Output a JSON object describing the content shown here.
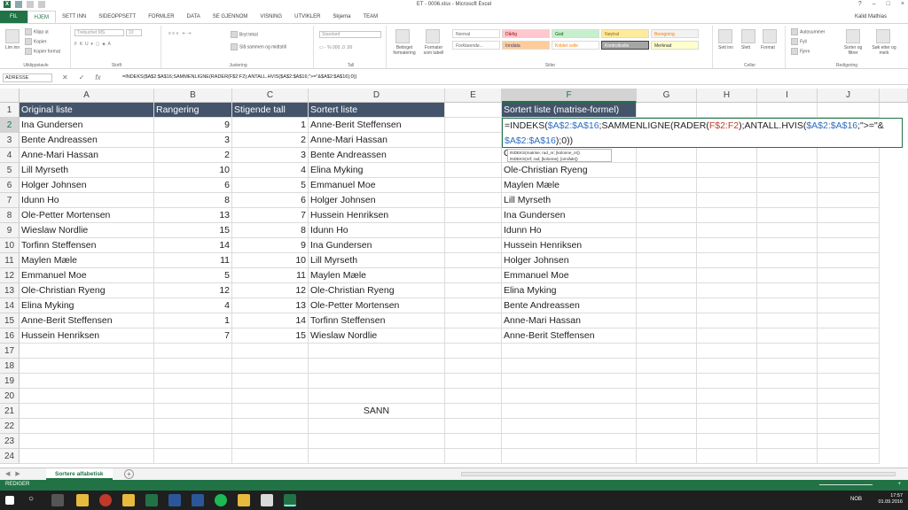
{
  "window": {
    "title": "ET - 0006.xlsx - Microsoft Excel",
    "user": "Kalid Mathias",
    "controls": [
      "?",
      "–",
      "□",
      "×"
    ]
  },
  "ribbon_tabs": [
    "FIL",
    "HJEM",
    "SETT INN",
    "SIDEOPPSETT",
    "FORMLER",
    "DATA",
    "SE GJENNOM",
    "VISNING",
    "UTVIKLER",
    "Skjema",
    "TEAM"
  ],
  "ribbon": {
    "clipboard": {
      "paste": "Lim inn",
      "cut": "Klipp ut",
      "copy": "Kopier",
      "format_painter": "Kopier format",
      "label": "Utklippstavle"
    },
    "font": {
      "family": "Trebuchet MS",
      "size": "10",
      "label": "Skrift"
    },
    "alignment": {
      "wrap": "Bryt tekst",
      "merge": "Slå sammen og midtstill",
      "label": "Justering"
    },
    "number": {
      "format": "Standard",
      "label": "Tall"
    },
    "styles": {
      "conditional": "Betinget formatering",
      "format_table": "Formater som tabell",
      "cells": [
        "Normal",
        "Dårlig",
        "God",
        "Nøytral",
        "Beregning",
        "Forklarende...",
        "Inndata",
        "Koblet celle",
        "Kontrollcelle",
        "Merknad"
      ],
      "label": "Stiler"
    },
    "cells": {
      "insert": "Sett inn",
      "delete": "Slett",
      "format": "Format",
      "label": "Celler"
    },
    "editing": {
      "autosum": "Autosummer",
      "fill": "Fyll",
      "clear": "Fjern",
      "sort": "Sorter og filtrer",
      "find": "Søk etter og merk",
      "label": "Redigering"
    }
  },
  "formula_bar": {
    "name_box": "ADRESSE",
    "formula": "=INDEKS($A$2:$A$16;SAMMENLIGNE(RADER(F$2:F2);ANTALL.HVIS($A$2:$A$16;\">=\"&$A$2:$A$16);0))"
  },
  "columns": [
    "A",
    "B",
    "C",
    "D",
    "E",
    "F",
    "G",
    "H",
    "I",
    "J"
  ],
  "rows": [
    "1",
    "2",
    "3",
    "4",
    "5",
    "6",
    "7",
    "8",
    "9",
    "10",
    "11",
    "12",
    "13",
    "14",
    "15",
    "16",
    "17",
    "18",
    "19",
    "20",
    "21",
    "22",
    "23",
    "24"
  ],
  "headers": {
    "original": "Original liste",
    "rank": "Rangering",
    "ascending": "Stigende tall",
    "sorted": "Sortert liste",
    "sorted_matrix": "Sortert liste (matrise-formel)"
  },
  "data": [
    {
      "a": "Ina Gundersen",
      "b": "9",
      "c": "1",
      "d": "Anne-Berit Steffensen",
      "f": ""
    },
    {
      "a": "Bente Andreassen",
      "b": "3",
      "c": "2",
      "d": "Anne-Mari Hassan",
      "f": ""
    },
    {
      "a": "Anne-Mari Hassan",
      "b": "2",
      "c": "3",
      "d": "Bente Andreassen",
      "f": ""
    },
    {
      "a": "Lill Myrseth",
      "b": "10",
      "c": "4",
      "d": "Elina Myking",
      "f": "Ole-Christian Ryeng"
    },
    {
      "a": "Holger Johnsen",
      "b": "6",
      "c": "5",
      "d": "Emmanuel Moe",
      "f": "Maylen Mæle"
    },
    {
      "a": "Idunn Ho",
      "b": "8",
      "c": "6",
      "d": "Holger Johnsen",
      "f": "Lill Myrseth"
    },
    {
      "a": "Ole-Petter Mortensen",
      "b": "13",
      "c": "7",
      "d": "Hussein Henriksen",
      "f": "Ina Gundersen"
    },
    {
      "a": "Wieslaw Nordlie",
      "b": "15",
      "c": "8",
      "d": "Idunn Ho",
      "f": "Idunn Ho"
    },
    {
      "a": "Torfinn Steffensen",
      "b": "14",
      "c": "9",
      "d": "Ina Gundersen",
      "f": "Hussein Henriksen"
    },
    {
      "a": "Maylen Mæle",
      "b": "11",
      "c": "10",
      "d": "Lill Myrseth",
      "f": "Holger Johnsen"
    },
    {
      "a": "Emmanuel Moe",
      "b": "5",
      "c": "11",
      "d": "Maylen Mæle",
      "f": "Emmanuel Moe"
    },
    {
      "a": "Ole-Christian Ryeng",
      "b": "12",
      "c": "12",
      "d": "Ole-Christian Ryeng",
      "f": "Elina Myking"
    },
    {
      "a": "Elina Myking",
      "b": "4",
      "c": "13",
      "d": "Ole-Petter Mortensen",
      "f": "Bente Andreassen"
    },
    {
      "a": "Anne-Berit Steffensen",
      "b": "1",
      "c": "14",
      "d": "Torfinn Steffensen",
      "f": "Anne-Mari Hassan"
    },
    {
      "a": "Hussein Henriksen",
      "b": "7",
      "c": "15",
      "d": "Wieslaw Nordlie",
      "f": "Anne-Berit Steffensen"
    }
  ],
  "extra": {
    "d21": "SANN"
  },
  "editing_formula": {
    "p1": "=INDEKS(",
    "r1": "$A$2:$A$16",
    "p2": ";SAMMENLIGNE(RADER(",
    "r2": "F$2:F2",
    "p3": ");ANTALL.HVIS(",
    "r3": "$A$2:$A$16",
    "p4": ";\">=\"&",
    "r4": "$A$2:$A$16",
    "p5": ");0))",
    "stub": "O"
  },
  "tooltip": {
    "line1": "INDEKS(matrise; rad_nr; [kolonne_nr])",
    "line2": "INDEKS(ref; rad; [kolonne]; [område])"
  },
  "sheet_tab": "Sortere alfabetisk",
  "status": {
    "mode": "REDIGER",
    "zoom": "+"
  },
  "taskbar": {
    "lang": "NOB",
    "time": "17:57",
    "date": "01.09.2016"
  }
}
